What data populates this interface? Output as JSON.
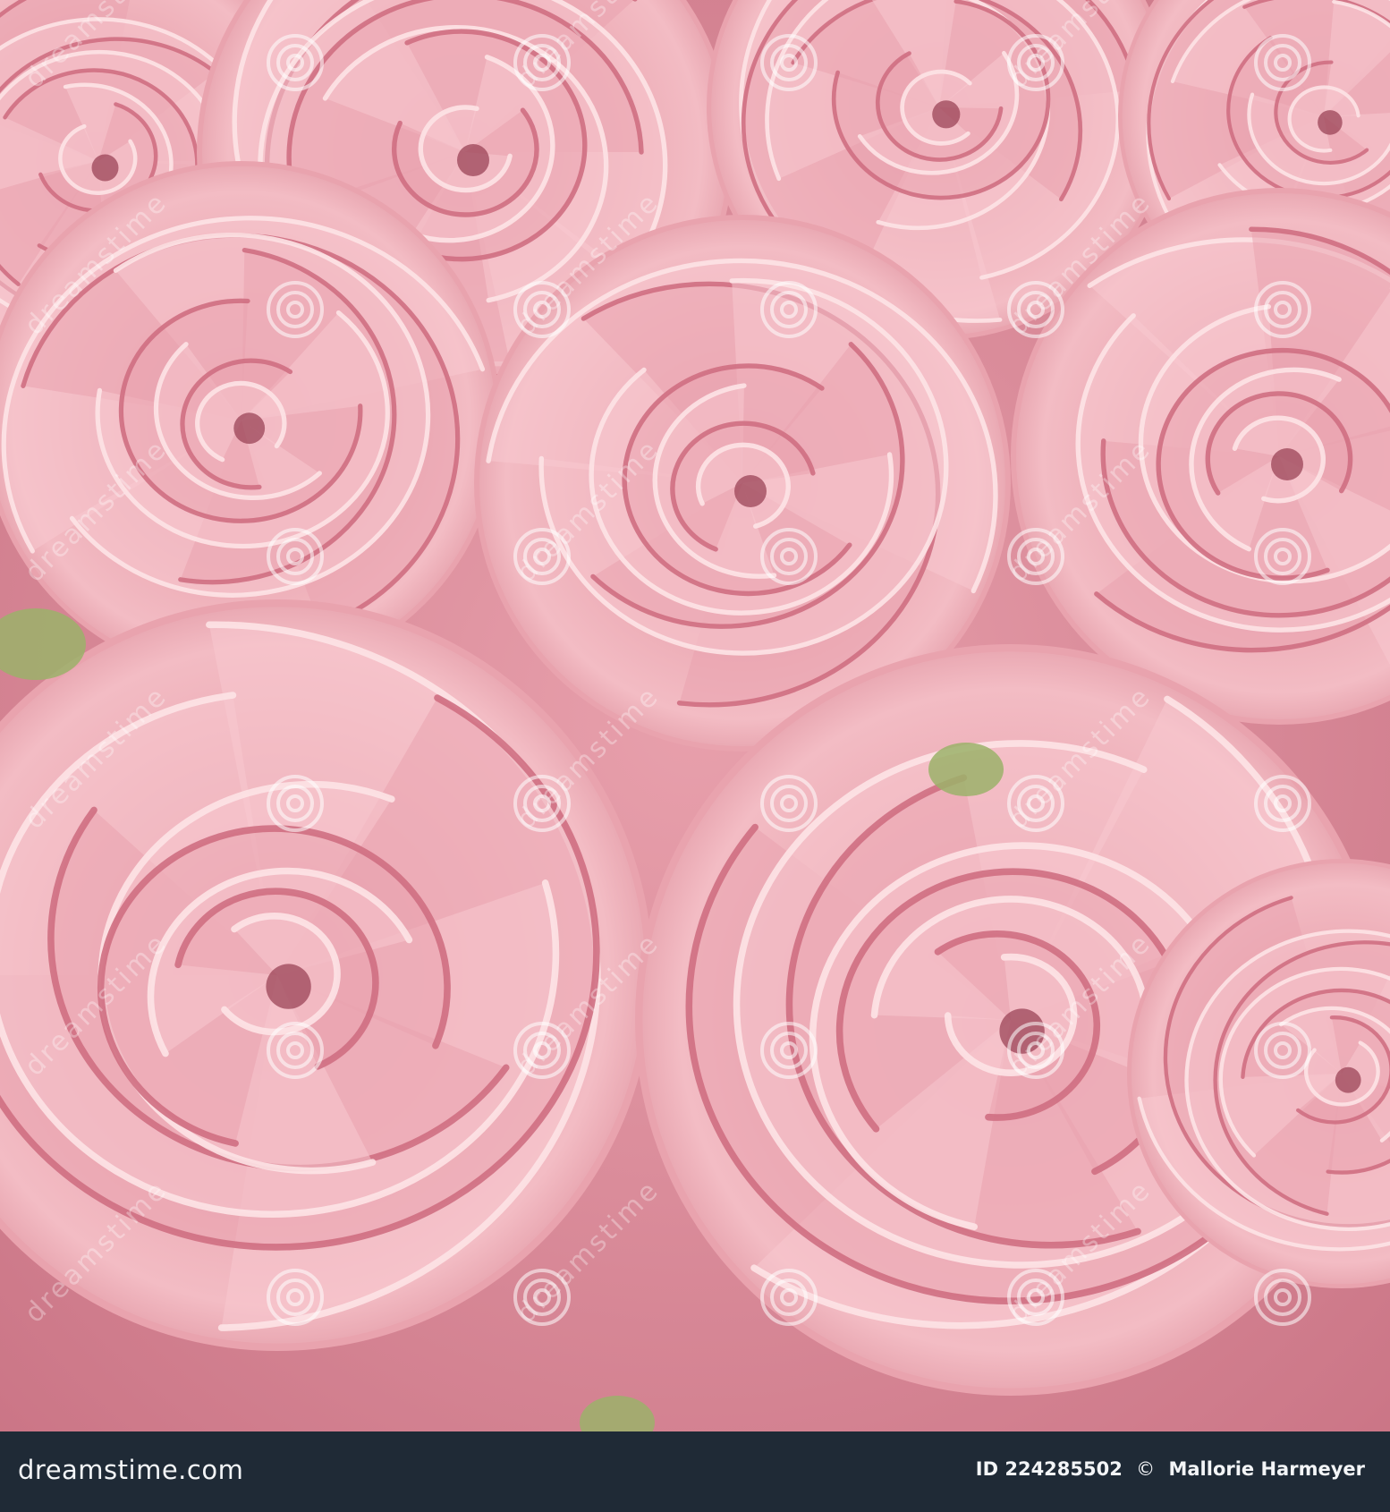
{
  "photo": {
    "subject": "pink roses close-up",
    "watermark_text": "dreamstime",
    "palette": {
      "petal_light": "#f7c9cf",
      "petal_mid": "#e9a3ae",
      "petal_deep": "#cf6f82",
      "shadow": "#9b4457",
      "leaf": "#9bb26a"
    }
  },
  "footer": {
    "background": "#1f2a36",
    "brand": "dreamstime.com",
    "id_label": "ID",
    "id_value": "224285502",
    "copyright_symbol": "©",
    "author": "Mallorie Harmeyer"
  }
}
